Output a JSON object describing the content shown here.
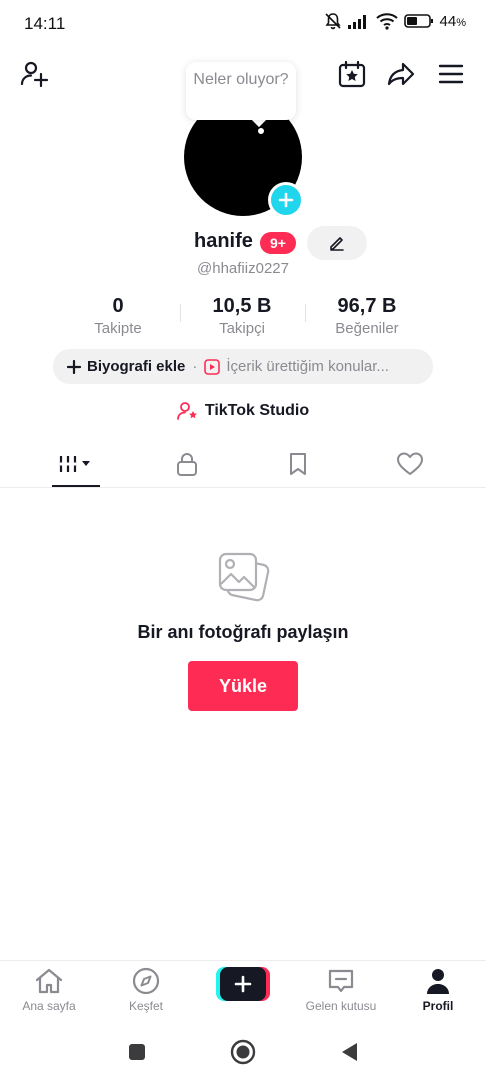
{
  "status_bar": {
    "time": "14:11",
    "battery_percent": "44",
    "battery_suffix": "%"
  },
  "top_bar": {
    "icons": [
      "add-friend-icon",
      "calendar-star-icon",
      "share-icon",
      "menu-icon"
    ]
  },
  "profile": {
    "status_bubble": "Neler oluyor?",
    "name": "hanife",
    "notification_badge": "9+",
    "handle": "@hhafiiz0227"
  },
  "stats": [
    {
      "value": "0",
      "label": "Takipte"
    },
    {
      "value": "10,5 B",
      "label": "Takipçi"
    },
    {
      "value": "96,7 B",
      "label": "Beğeniler"
    }
  ],
  "bio": {
    "add_label": "Biyografi ekle",
    "separator": "·",
    "topic_label": "İçerik ürettiğim konular..."
  },
  "studio_label": "TikTok Studio",
  "tabs": [
    "videos-grid-icon",
    "lock-icon",
    "bookmark-icon",
    "heart-icon"
  ],
  "empty_state": {
    "title": "Bir anı fotoğrafı paylaşın",
    "button": "Yükle"
  },
  "bottom_nav": [
    {
      "label": "Ana sayfa",
      "icon": "home-icon"
    },
    {
      "label": "Keşfet",
      "icon": "compass-icon"
    },
    {
      "label": "",
      "icon": "create-plus-icon"
    },
    {
      "label": "Gelen kutusu",
      "icon": "inbox-icon"
    },
    {
      "label": "Profil",
      "icon": "profile-icon"
    }
  ],
  "colors": {
    "accent": "#fe2c55",
    "cyan": "#25f4ee",
    "text": "#161823",
    "muted": "#8a8b91"
  }
}
